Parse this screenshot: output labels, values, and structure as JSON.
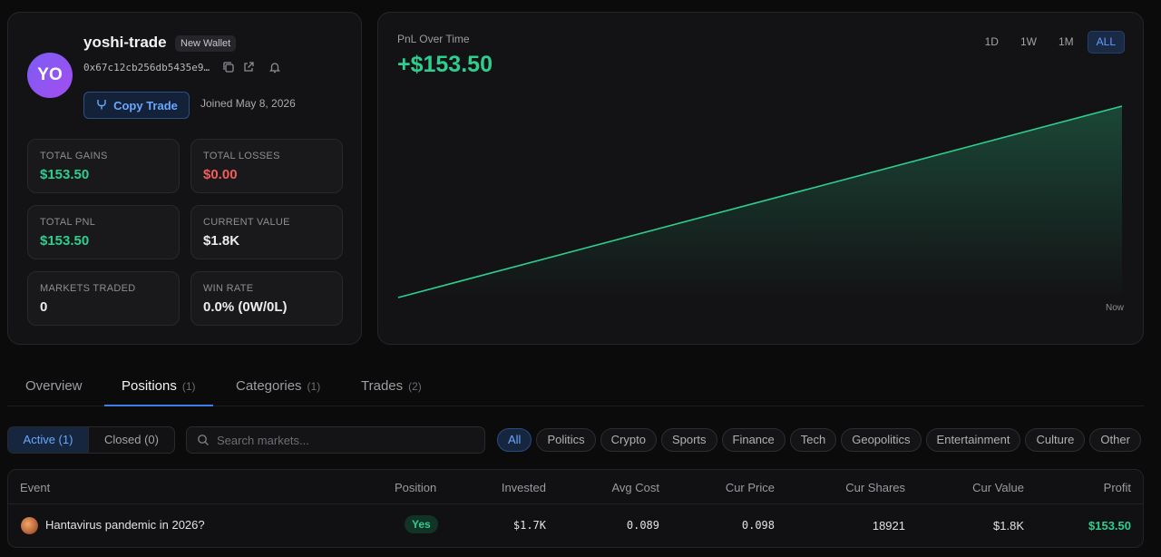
{
  "profile": {
    "avatar_initials": "YO",
    "username": "yoshi-trade",
    "badge": "New Wallet",
    "address": "0x67c12cb256db5435e9…",
    "copy_trade_label": "Copy Trade",
    "joined": "Joined May 8, 2026",
    "stats": [
      {
        "label": "TOTAL GAINS",
        "value": "$153.50",
        "tone": "green"
      },
      {
        "label": "TOTAL LOSSES",
        "value": "$0.00",
        "tone": "red"
      },
      {
        "label": "TOTAL PNL",
        "value": "$153.50",
        "tone": "green"
      },
      {
        "label": "CURRENT VALUE",
        "value": "$1.8K",
        "tone": "neutral"
      },
      {
        "label": "MARKETS TRADED",
        "value": "0",
        "tone": "neutral"
      },
      {
        "label": "WIN RATE",
        "value": "0.0% (0W/0L)",
        "tone": "neutral"
      }
    ],
    "icons": {
      "copy": "copy-icon",
      "external": "external-link-icon",
      "bell": "bell-icon",
      "copy_trade": "branch-icon"
    }
  },
  "chart": {
    "title": "PnL Over Time",
    "value": "+$153.50",
    "ranges": [
      "1D",
      "1W",
      "1M",
      "ALL"
    ],
    "active_range": "ALL",
    "end_label": "Now",
    "line_color": "#2fce8e"
  },
  "chart_data": {
    "type": "area",
    "title": "PnL Over Time",
    "x": [
      0,
      1
    ],
    "y": [
      0,
      153.5
    ],
    "x_end_label": "Now",
    "grid": false,
    "legend": "none"
  },
  "tabs": [
    {
      "label": "Overview",
      "count": ""
    },
    {
      "label": "Positions",
      "count": "(1)"
    },
    {
      "label": "Categories",
      "count": "(1)"
    },
    {
      "label": "Trades",
      "count": "(2)"
    }
  ],
  "active_tab": "Positions",
  "filters": {
    "status": [
      "Active (1)",
      "Closed (0)"
    ],
    "active_status": "Active (1)",
    "search_placeholder": "Search markets...",
    "categories": [
      "All",
      "Politics",
      "Crypto",
      "Sports",
      "Finance",
      "Tech",
      "Geopolitics",
      "Entertainment",
      "Culture",
      "Other"
    ],
    "active_category": "All"
  },
  "table": {
    "headers": [
      "Event",
      "Position",
      "Invested",
      "Avg Cost",
      "Cur Price",
      "Cur Shares",
      "Cur Value",
      "Profit"
    ],
    "rows": [
      {
        "event": "Hantavirus pandemic in 2026?",
        "position": "Yes",
        "invested": "$1.7K",
        "avg_cost": "0.089",
        "cur_price": "0.098",
        "cur_shares": "18921",
        "cur_value": "$1.8K",
        "profit": "$153.50"
      }
    ]
  },
  "colors": {
    "accent": "#3f7ee8",
    "positive": "#2fce8e",
    "negative": "#f25c5c",
    "background": "#0b0b0c"
  }
}
